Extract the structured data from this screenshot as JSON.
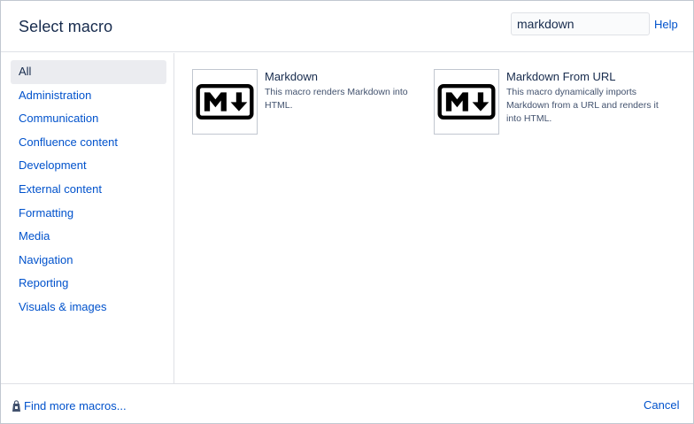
{
  "dialog": {
    "title": "Select macro",
    "search": {
      "value": "markdown",
      "placeholder": ""
    },
    "help_label": "Help"
  },
  "sidebar": {
    "items": [
      {
        "label": "All",
        "selected": true
      },
      {
        "label": "Administration"
      },
      {
        "label": "Communication"
      },
      {
        "label": "Confluence content"
      },
      {
        "label": "Development"
      },
      {
        "label": "External content"
      },
      {
        "label": "Formatting"
      },
      {
        "label": "Media"
      },
      {
        "label": "Navigation"
      },
      {
        "label": "Reporting"
      },
      {
        "label": "Visuals & images"
      }
    ]
  },
  "results": [
    {
      "name": "Markdown",
      "description": "This macro renders Markdown into HTML.",
      "icon": "markdown-icon"
    },
    {
      "name": "Markdown From URL",
      "description": "This macro dynamically imports Markdown from a URL and renders it into HTML.",
      "icon": "markdown-icon"
    }
  ],
  "footer": {
    "find_more_label": "Find more macros...",
    "cancel_label": "Cancel"
  },
  "colors": {
    "link": "#0052cc",
    "text": "#172b4d",
    "selected_bg": "#ebecf0",
    "border": "#dfe1e6"
  }
}
